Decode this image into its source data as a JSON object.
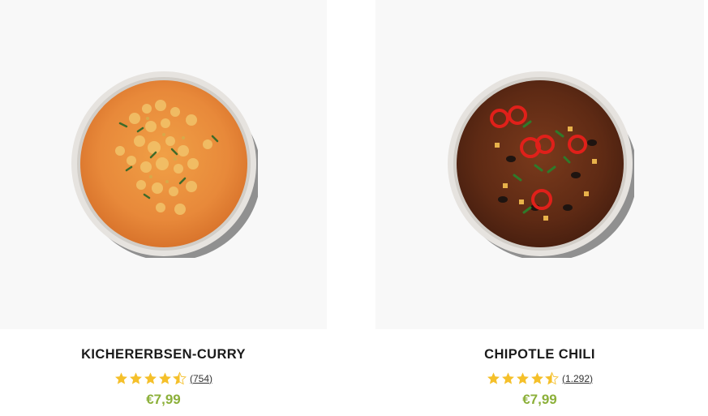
{
  "products": [
    {
      "title": "KICHERERBSEN-CURRY",
      "rating_value": 4.5,
      "rating_max": 5,
      "review_count": "(754)",
      "price": "€7,99",
      "image_icon": "curry-bowl-photo"
    },
    {
      "title": "CHIPOTLE CHILI",
      "rating_value": 4.5,
      "rating_max": 5,
      "review_count": "(1.292)",
      "price": "€7,99",
      "image_icon": "chili-bowl-photo"
    }
  ],
  "colors": {
    "star": "#f5c02a",
    "price": "#8cb03a",
    "tile_bg": "#f8f8f8"
  }
}
